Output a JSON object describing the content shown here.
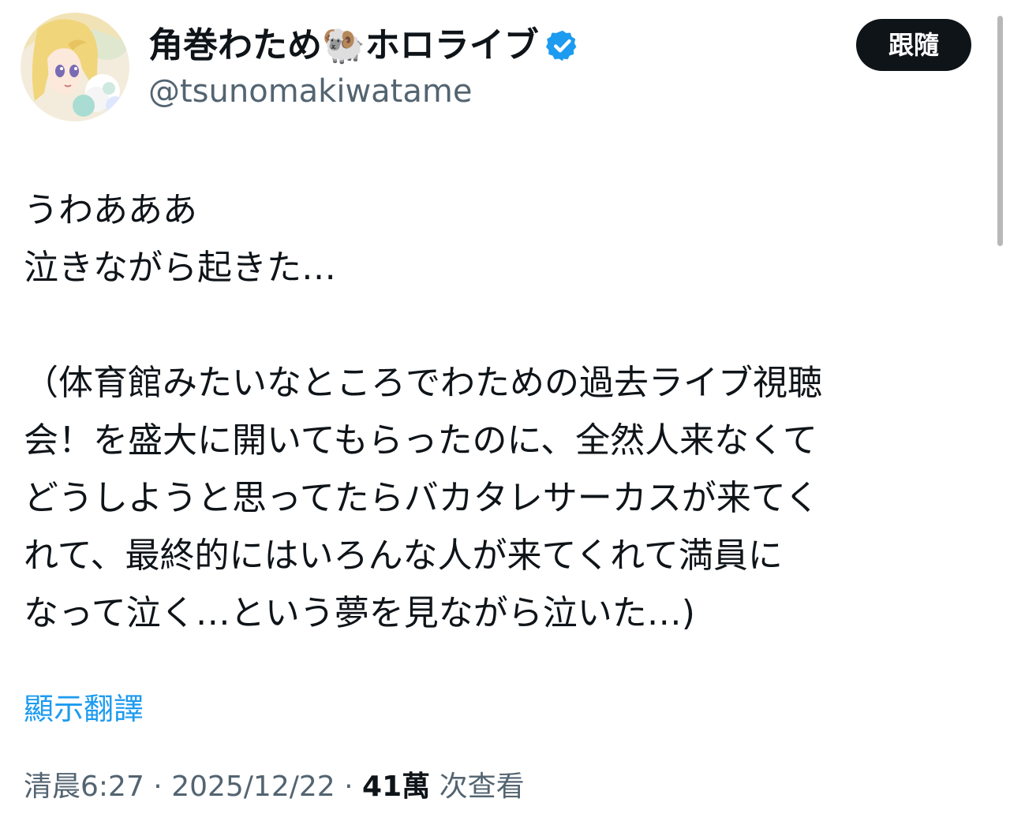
{
  "author": {
    "display_name": "角巻わため🐏ホロライブ",
    "handle": "@tsunomakiwatame",
    "verified": true,
    "avatar_icon": "anime-girl-avatar"
  },
  "follow_button": {
    "label": "跟隨"
  },
  "tweet": {
    "lines": [
      "うわあああ",
      "泣きながら起きた…",
      "",
      "（体育館みたいなところでわための過去ライブ視聴",
      "会！を盛大に開いてもらったのに、全然人来なくて",
      "どうしようと思ってたらバカタレサーカスが来てく",
      "れて、最終的にはいろんな人が来てくれて満員に",
      "なって泣く…という夢を見ながら泣いた…)"
    ]
  },
  "translate": {
    "label": "顯示翻譯"
  },
  "meta": {
    "time": "清晨6:27",
    "separator": " · ",
    "date": "2025/12/22",
    "views_count": "41萬",
    "views_label": " 次查看"
  },
  "colors": {
    "text": "#0f1419",
    "secondary": "#536471",
    "link": "#1d9bf0",
    "verified": "#1d9bf0",
    "button_bg": "#0f1419"
  }
}
